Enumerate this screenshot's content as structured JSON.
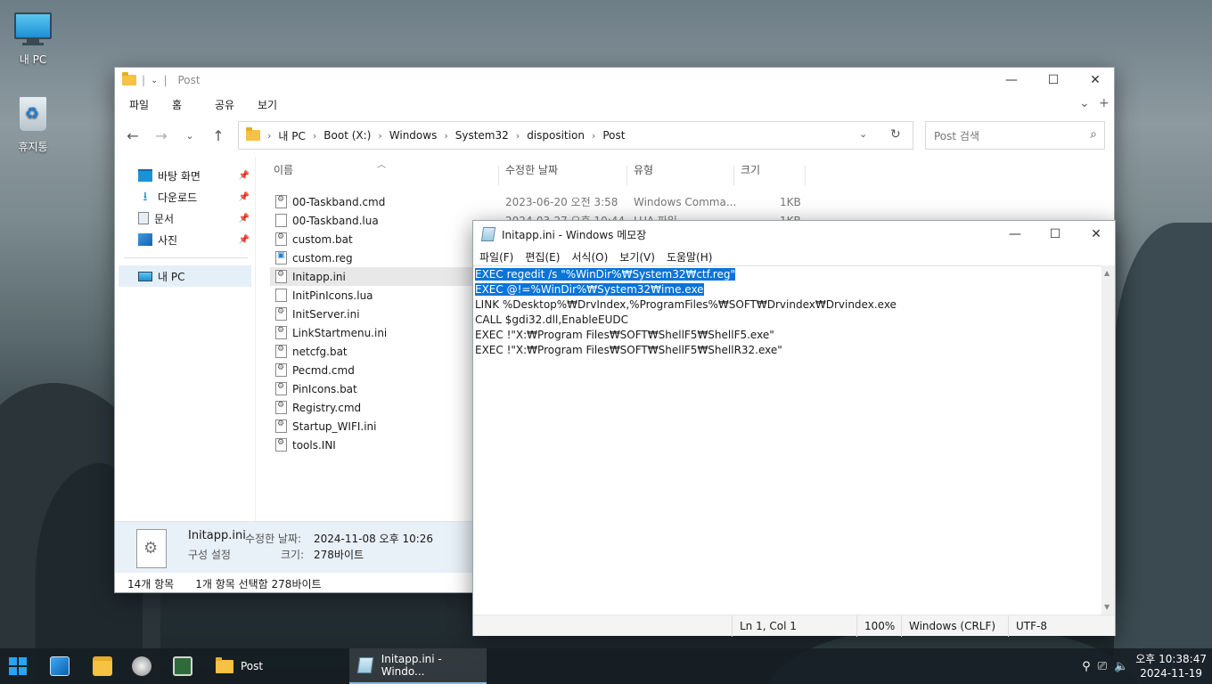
{
  "desktop": {
    "icons": [
      {
        "label": "내 PC"
      },
      {
        "label": "휴지통"
      }
    ]
  },
  "explorer": {
    "title": "Post",
    "ribbon_tabs": [
      "파일",
      "홈",
      "공유",
      "보기"
    ],
    "breadcrumb": [
      "내 PC",
      "Boot (X:)",
      "Windows",
      "System32",
      "disposition",
      "Post"
    ],
    "search_placeholder": "Post 검색",
    "nav": {
      "quick_access": [
        {
          "label": "바탕 화면",
          "icon": "desktop-icon"
        },
        {
          "label": "다운로드",
          "icon": "download-icon"
        },
        {
          "label": "문서",
          "icon": "document-icon"
        },
        {
          "label": "사진",
          "icon": "pictures-icon"
        }
      ],
      "this_pc": "내 PC"
    },
    "columns": [
      "이름",
      "수정한 날짜",
      "유형",
      "크기"
    ],
    "files": [
      {
        "name": "00-Taskband.cmd",
        "date": "2023-06-20 오전 3:58",
        "type": "Windows Comma...",
        "size": "1KB",
        "icon": "cfg"
      },
      {
        "name": "00-Taskband.lua",
        "date": "2024-03-27 오후 10:44",
        "type": "LUA 파일",
        "size": "1KB",
        "icon": "blank"
      },
      {
        "name": "custom.bat",
        "icon": "cfg"
      },
      {
        "name": "custom.reg",
        "icon": "reg"
      },
      {
        "name": "Initapp.ini",
        "icon": "cfg",
        "selected": true
      },
      {
        "name": "InitPinIcons.lua",
        "icon": "blank"
      },
      {
        "name": "InitServer.ini",
        "icon": "cfg"
      },
      {
        "name": "LinkStartmenu.ini",
        "icon": "cfg"
      },
      {
        "name": "netcfg.bat",
        "icon": "cfg"
      },
      {
        "name": "Pecmd.cmd",
        "icon": "cfg"
      },
      {
        "name": "PinIcons.bat",
        "icon": "cfg"
      },
      {
        "name": "Registry.cmd",
        "icon": "cfg"
      },
      {
        "name": "Startup_WIFI.ini",
        "icon": "cfg"
      },
      {
        "name": "tools.INI",
        "icon": "cfg"
      }
    ],
    "details": {
      "filename": "Initapp.ini",
      "modified_label": "수정한 날짜:",
      "modified_value": "2024-11-08 오후 10:26",
      "type": "구성 설정",
      "size_label": "크기:",
      "size_value": "278바이트"
    },
    "status": {
      "item_count": "14개 항목",
      "selection": "1개 항목 선택함 278바이트"
    }
  },
  "notepad": {
    "title": "Initapp.ini - Windows 메모장",
    "menu": [
      "파일(F)",
      "편집(E)",
      "서식(O)",
      "보기(V)",
      "도움말(H)"
    ],
    "lines": [
      {
        "text": "EXEC regedit /s \"%WinDir%₩System32₩ctf.reg\"",
        "highlight": true
      },
      {
        "text": "EXEC @!=%WinDir%₩System32₩ime.exe",
        "highlight": true
      },
      {
        "text": "LINK %Desktop%₩DrvIndex,%ProgramFiles%₩SOFT₩Drvindex₩Drvindex.exe",
        "highlight": false
      },
      {
        "text": "CALL $gdi32.dll,EnableEUDC",
        "highlight": false
      },
      {
        "text": "EXEC !\"X:₩Program Files₩SOFT₩ShellF5₩ShellF5.exe\"",
        "highlight": false
      },
      {
        "text": "EXEC !\"X:₩Program Files₩SOFT₩ShellF5₩ShellR32.exe\"",
        "highlight": false
      }
    ],
    "status": {
      "position": "Ln 1, Col 1",
      "zoom": "100%",
      "line_ending": "Windows (CRLF)",
      "encoding": "UTF-8"
    }
  },
  "taskbar": {
    "tasks": [
      {
        "label": "Post"
      },
      {
        "label": "Initapp.ini - Windo..."
      }
    ],
    "clock": {
      "time": "오후 10:38:47",
      "date": "2024-11-19"
    }
  },
  "colors": {
    "selection": "#0b74d8",
    "accent": "#2aa3f0",
    "folder": "#f5c242"
  }
}
